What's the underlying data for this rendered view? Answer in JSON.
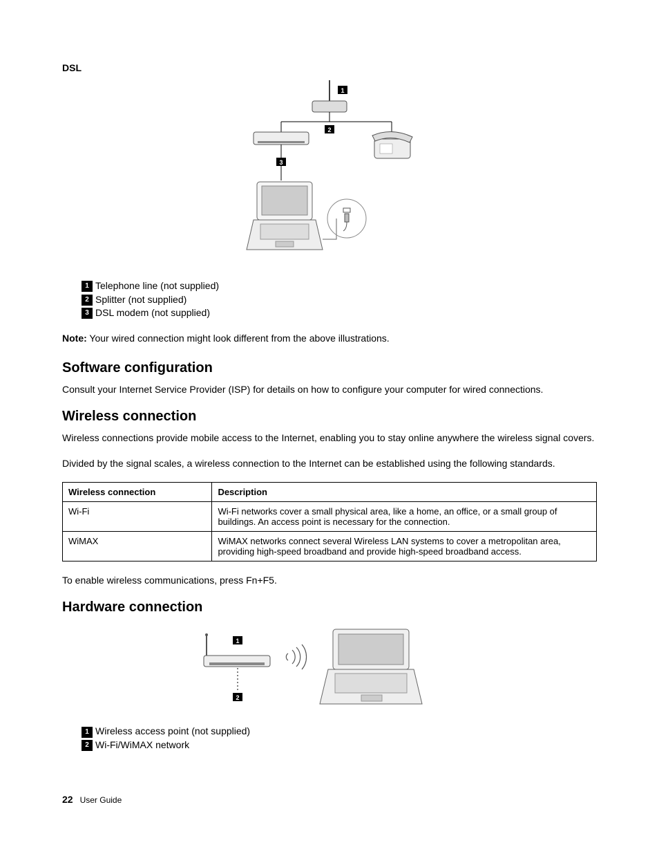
{
  "dsl": {
    "title": "DSL",
    "callouts": {
      "c1": "1",
      "c2": "2",
      "c3": "3"
    },
    "legend": {
      "l1": "Telephone line (not supplied)",
      "l2": "Splitter (not supplied)",
      "l3": "DSL modem (not supplied)"
    }
  },
  "note": {
    "label": "Note:",
    "text": " Your wired connection might look different from the above illustrations."
  },
  "software": {
    "heading": "Software configuration",
    "body": "Consult your Internet Service Provider (ISP) for details on how to configure your computer for wired connections."
  },
  "wireless": {
    "heading": "Wireless connection",
    "p1": "Wireless connections provide mobile access to the Internet, enabling you to stay online anywhere the wireless signal covers.",
    "p2": "Divided by the signal scales, a wireless connection to the Internet can be established using the following standards.",
    "table": {
      "h1": "Wireless connection",
      "h2": "Description",
      "rows": [
        {
          "name": "Wi-Fi",
          "desc": "Wi-Fi networks cover a small physical area, like a home, an office, or a small group of buildings. An access point is necessary for the connection."
        },
        {
          "name": "WiMAX",
          "desc": "WiMAX networks connect several Wireless LAN systems to cover a metropolitan area, providing high-speed broadband and provide high-speed broadband access."
        }
      ]
    },
    "enable": "To enable wireless communications, press Fn+F5."
  },
  "hardware": {
    "heading": "Hardware connection",
    "callouts": {
      "c1": "1",
      "c2": "2"
    },
    "legend": {
      "l1": "Wireless access point (not supplied)",
      "l2": "Wi-Fi/WiMAX network"
    }
  },
  "footer": {
    "page": "22",
    "title": "User Guide"
  }
}
